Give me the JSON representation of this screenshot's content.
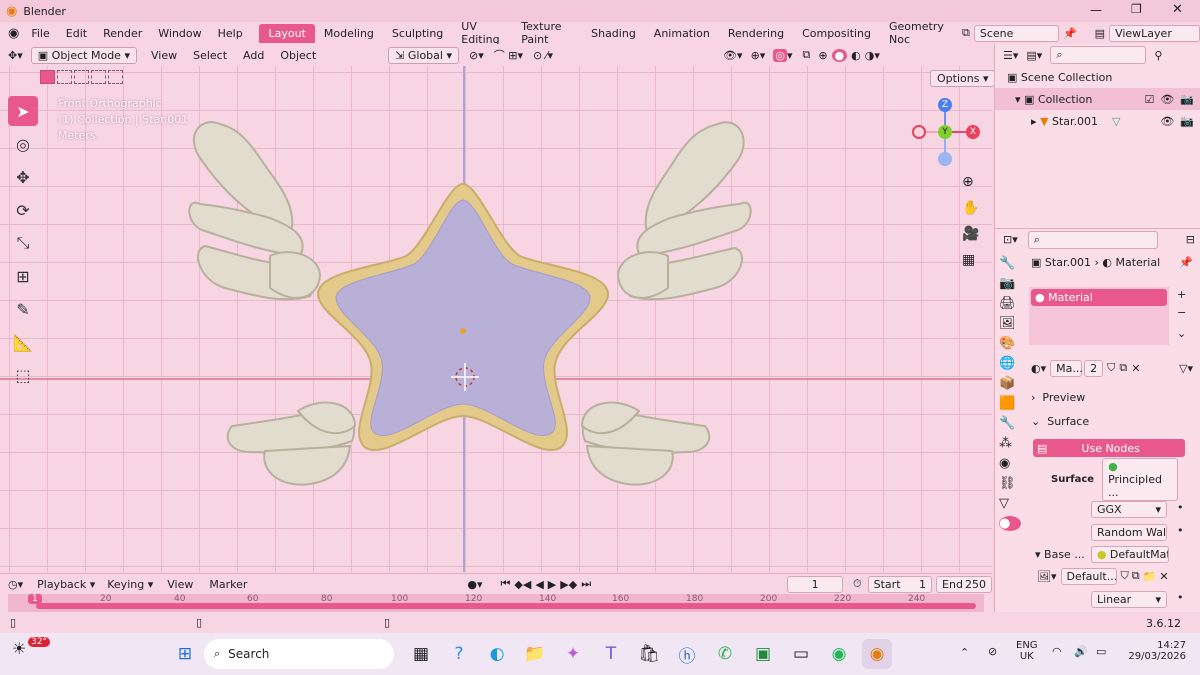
{
  "window": {
    "title": "Blender"
  },
  "menus": [
    "File",
    "Edit",
    "Render",
    "Window",
    "Help"
  ],
  "workspaces": [
    "Layout",
    "Modeling",
    "Sculpting",
    "UV Editing",
    "Texture Paint",
    "Shading",
    "Animation",
    "Rendering",
    "Compositing",
    "Geometry Noc"
  ],
  "scene": "Scene",
  "view_layer": "ViewLayer",
  "viewport_header": {
    "mode": "Object Mode",
    "items": [
      "View",
      "Select",
      "Add",
      "Object"
    ],
    "transform": "Global",
    "options": "Options"
  },
  "viewport_overlay": {
    "line1": "Front Orthographic",
    "line2": "(1) Collection | Star.001",
    "line3": "Meters"
  },
  "gizmo": {
    "z": "Z",
    "y": "Y",
    "x": "X"
  },
  "outliner": {
    "root": "Scene Collection",
    "collection": "Collection",
    "object": "Star.001"
  },
  "properties": {
    "breadcrumb_obj": "Star.001",
    "breadcrumb_tab": "Material",
    "slot": "Material",
    "mat_short": "Ma...",
    "users": "2",
    "preview": "Preview",
    "surface_section": "Surface",
    "use_nodes": "Use Nodes",
    "surface_label": "Surface",
    "surface_value": "Principled ...",
    "dist": "GGX",
    "sss": "Random Walk",
    "base_label": "Base ...",
    "base_value": "DefaultMat...",
    "image_value": "Default...",
    "interp": "Linear"
  },
  "timeline": {
    "playback": "Playback",
    "keying": "Keying",
    "view": "View",
    "marker": "Marker",
    "frame": "1",
    "start_label": "Start",
    "start": "1",
    "end_label": "End",
    "end": "250",
    "ticks": [
      "20",
      "40",
      "60",
      "80",
      "100",
      "120",
      "140",
      "160",
      "180",
      "200",
      "220",
      "240"
    ],
    "current_frame": "1"
  },
  "status": {
    "version": "3.6.12"
  },
  "taskbar": {
    "temp": "32°",
    "search": "Search",
    "lang1": "ENG",
    "lang2": "UK",
    "time": "14:27",
    "date": "29/03/2026"
  },
  "colors": {
    "accent": "#e8588a",
    "bg": "#f7d5e2",
    "star": "#b9b0d8",
    "star_rim": "#e3c98a",
    "wing": "#e2dccf"
  }
}
